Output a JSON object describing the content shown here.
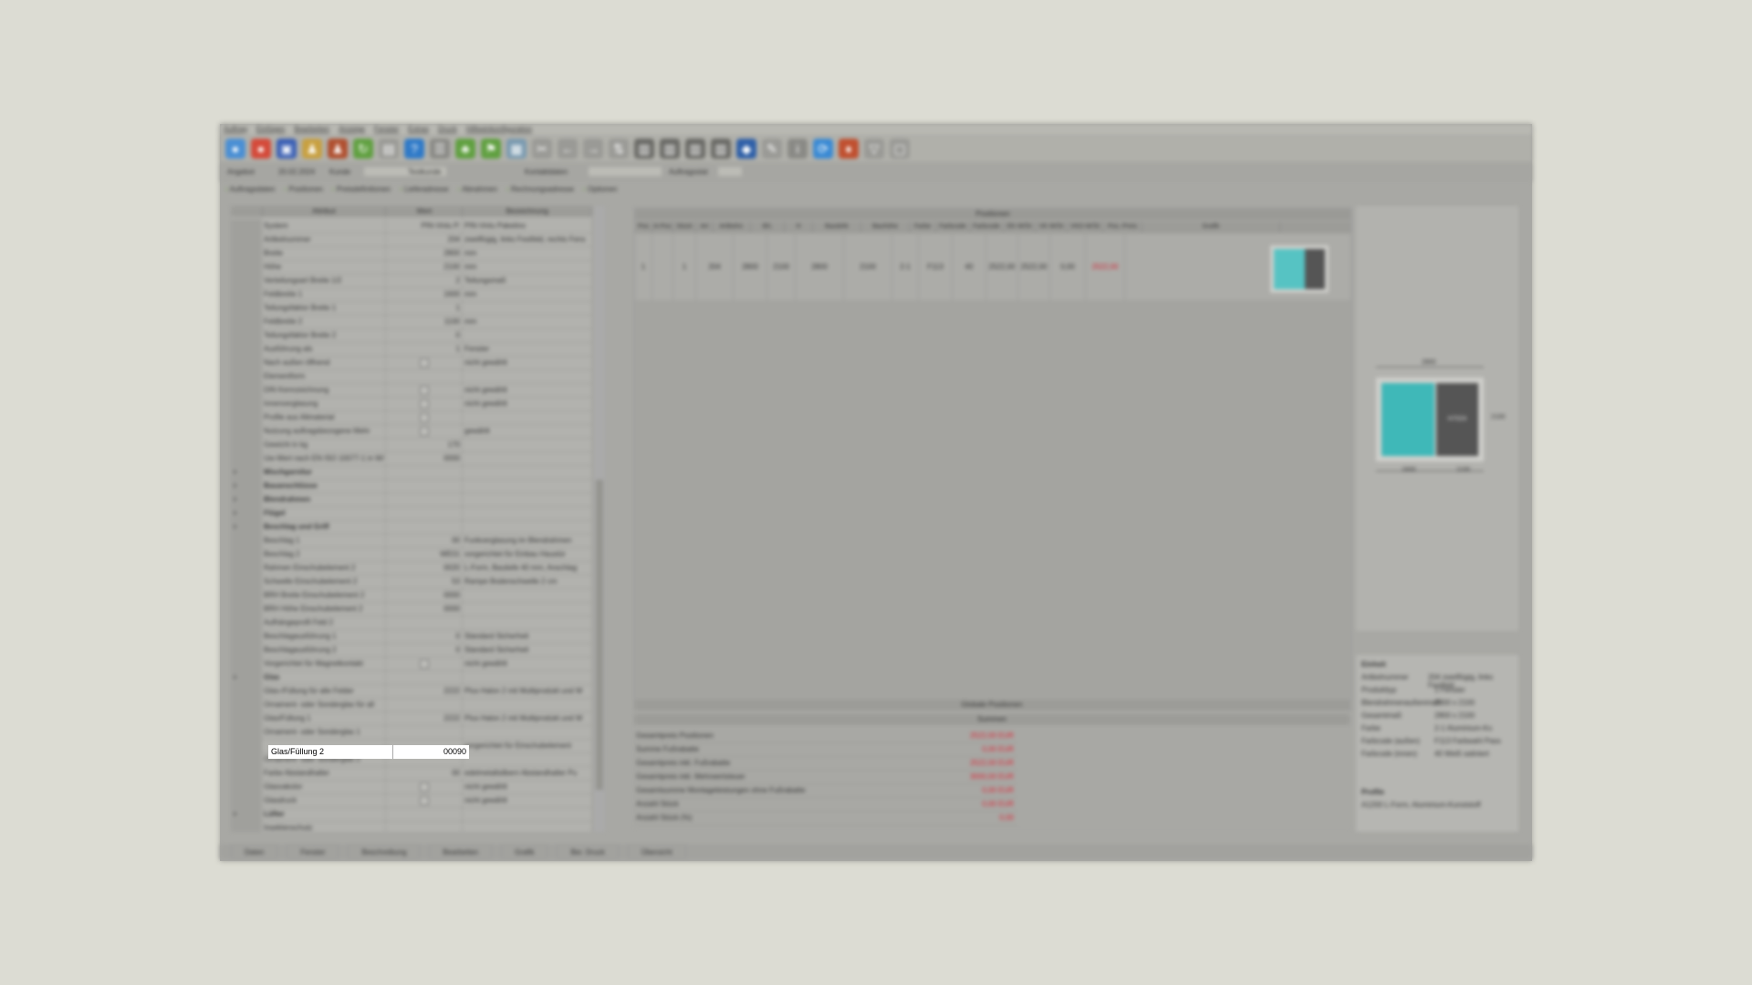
{
  "menu": [
    "Auftrag",
    "Einfügen",
    "Bearbeiten",
    "Anzeige",
    "Fenster",
    "Extras",
    "Druck",
    "Hilfeeinkonfiguration"
  ],
  "infobar": {
    "angebot_label": "Angebot",
    "angebot_value": "20.02.2024",
    "kunde_label": "Kunde",
    "kunde_value": "Testkunde",
    "kontakt_label": "Kontaktdaten",
    "auftrag_label": "Auftragsstat"
  },
  "tabs": [
    "Auftragsdaten",
    "Positionen",
    "Preisdefinitionen",
    "Lieferadresse",
    "Abnahmen",
    "Rechnungsadresse",
    "Optionen"
  ],
  "left_table": {
    "columns": [
      "Attribut",
      "Wert",
      "Bezeichnung"
    ],
    "rows": [
      {
        "attr": "System",
        "val": "PIN-Vinlu P.",
        "desc": "PIN-Vinlu Paketino"
      },
      {
        "attr": "Artikelnummer",
        "val": "204",
        "desc": "zweiflügig, links Festfeld, rechts Fens"
      },
      {
        "attr": "Breite",
        "val": "2800",
        "desc": "mm"
      },
      {
        "attr": "Höhe",
        "val": "2100",
        "desc": "mm"
      },
      {
        "attr": "Verteilungsart Breite 1/2",
        "val": "2",
        "desc": "Teilungsmaß"
      },
      {
        "attr": "Feldbreite 1",
        "val": "1600",
        "desc": "mm"
      },
      {
        "attr": "Teilungsfaktor Breite 1",
        "val": "1",
        "desc": ""
      },
      {
        "attr": "Feldbreite 2",
        "val": "1100",
        "desc": "mm"
      },
      {
        "attr": "Teilungsfaktor Breite 2",
        "val": "0",
        "desc": ""
      },
      {
        "attr": "Ausführung als",
        "val": "1",
        "desc": "Fenster"
      },
      {
        "attr": "Nach außen öffnend",
        "val": "",
        "desc": "nicht gewählt",
        "check": true
      },
      {
        "attr": "Elementform",
        "val": "",
        "desc": ""
      },
      {
        "attr": "DIN Kennzeichnung",
        "val": "",
        "desc": "nicht gewählt",
        "check": true
      },
      {
        "attr": "Innenverglasung",
        "val": "",
        "desc": "nicht gewählt",
        "check": true
      },
      {
        "attr": "Profile aus Altmaterial",
        "val": "",
        "desc": "",
        "check": true
      },
      {
        "attr": "Nutzung auftragsbezogene Mehr",
        "val": "",
        "desc": "gewählt",
        "check": true
      },
      {
        "attr": "Gewicht in kg",
        "val": "170",
        "desc": ""
      },
      {
        "attr": "Uw-Wert nach EN ISO 10077-1 in W/",
        "val": "0000",
        "desc": ""
      },
      {
        "attr": "Mischgarnitur",
        "val": "",
        "desc": "",
        "group": true
      },
      {
        "attr": "Bauanschlüsse",
        "val": "",
        "desc": "",
        "group": true
      },
      {
        "attr": "Blendrahmen",
        "val": "",
        "desc": "",
        "group": true
      },
      {
        "attr": "Flügel",
        "val": "",
        "desc": "",
        "group": true
      },
      {
        "attr": "Beschlag und Griff",
        "val": "",
        "desc": "",
        "group": true
      },
      {
        "attr": "Beschlag 1",
        "val": "00",
        "desc": "Funkverglasung im Blendrahmen"
      },
      {
        "attr": "Beschlag 2",
        "val": "WE01",
        "desc": "vorgerichtet für Einbau Haustür"
      },
      {
        "attr": "Rahmen Einschubelement 2",
        "val": "0020",
        "desc": "L-Form, Bautiefe 40 mm, Anschlag"
      },
      {
        "attr": "Schwelle Einschubelement 2",
        "val": "53",
        "desc": "Rampe Bodenschwelle 2 cm"
      },
      {
        "attr": "BRH Breite Einschubelement 2",
        "val": "0000",
        "desc": ""
      },
      {
        "attr": "BRH Höhe Einschubelement 2",
        "val": "0000",
        "desc": ""
      },
      {
        "attr": "Aufhängeprofil Feld 2",
        "val": "",
        "desc": ""
      },
      {
        "attr": "Beschlagausführung 1",
        "val": "0",
        "desc": "Standard Sicherheit"
      },
      {
        "attr": "Beschlagausführung 2",
        "val": "0",
        "desc": "Standard Sicherheit"
      },
      {
        "attr": "Vorgerichtet für Magnetkontakt",
        "val": "",
        "desc": "nicht gewählt",
        "check": true
      },
      {
        "attr": "Glas",
        "val": "",
        "desc": "",
        "group": true
      },
      {
        "attr": "Glas-/Füllung für alle Felder",
        "val": "2222",
        "desc": "Plus Halon 2 mit Multiprodukt und W"
      },
      {
        "attr": "Ornament- oder Sonderglas für all",
        "val": "",
        "desc": ""
      },
      {
        "attr": "Glas/Füllung 1",
        "val": "2222",
        "desc": "Plus Halon 2 mit Multiprodukt und W"
      },
      {
        "attr": "Ornament- oder Sonderglas 1",
        "val": "",
        "desc": ""
      },
      {
        "attr": "",
        "val": "",
        "desc": "vorgerichtet für Einschubelement"
      },
      {
        "attr": "Ornament- oder Sonderglas 2",
        "val": "",
        "desc": ""
      },
      {
        "attr": "Farbe Abstandhalter",
        "val": "00",
        "desc": "edelmetallsilbern Abstandhalter Pu"
      },
      {
        "attr": "Glasvakolor",
        "val": "",
        "desc": "nicht gewählt",
        "check": true
      },
      {
        "attr": "Glasdruck",
        "val": "",
        "desc": "nicht gewählt",
        "check": true
      },
      {
        "attr": "Lüfter",
        "val": "",
        "desc": "",
        "group": true
      },
      {
        "attr": "Insektenschutz",
        "val": "",
        "desc": ""
      }
    ]
  },
  "edit_row": {
    "label": "Glas/Füllung 2",
    "value": "00090"
  },
  "positions": {
    "title": "Positionen",
    "columns": [
      "Pos",
      "A-Pos",
      "Stück",
      "Art",
      "Artikelnr.",
      "B/L",
      "H",
      "Bautiefe",
      "Bauhöhe",
      "Farbe",
      "Farbcode",
      "Farbcode",
      "EK-W/St",
      "VK-W/St",
      "VKD-W/St",
      "Pos.-Preis",
      "Grafik"
    ],
    "row": [
      "1",
      "",
      "1",
      "204",
      "2800",
      "2100",
      "2800",
      "2100",
      "2-1",
      "F113",
      "40",
      "2522,00",
      "2522,00",
      "0,00",
      "2522,00"
    ]
  },
  "global_positions": "Globale Positionen",
  "sums": {
    "title": "Summen",
    "rows": [
      {
        "label": "Gesamtpreis Positionen",
        "value": "2522,00 EUR"
      },
      {
        "label": "Summe Fußrabatte",
        "value": "0,00 EUR"
      },
      {
        "label": "Gesamtpreis inkl. Fußrabatte",
        "value": "2522,00 EUR"
      },
      {
        "label": "Gesamtpreis inkl. Mehrwertsteuer",
        "value": "3000,00 EUR"
      },
      {
        "label": "Gesamtsumme Montageleistungen ohne Fußrabatte",
        "value": "0,00 EUR"
      },
      {
        "label": "Anzahl Stück",
        "value": "0,00 EUR"
      },
      {
        "label": "Anzahl Stück (%)",
        "value": "0,00"
      }
    ]
  },
  "preview": {
    "dim_top": "2800",
    "dim_right": "2100",
    "dim_bottom_left": "1600",
    "dim_bottom_right": "1100",
    "panel_label": "H7024"
  },
  "info": {
    "section": "Einheit",
    "rows": [
      {
        "k": "Artikelnummer",
        "v": "204 zweiflügig, links Festfeld"
      },
      {
        "k": "Produkttyp",
        "v": "1 Fenster"
      },
      {
        "k": "Blendrahmenaußenmaß",
        "v": "2800 x 2100"
      },
      {
        "k": "Gesamtmaß",
        "v": "2800 x 2100"
      },
      {
        "k": "Farbe",
        "v": "2-1 Aluminium-Ko"
      },
      {
        "k": "Farbcode (außen)",
        "v": "F113 Farbwahl Pass"
      },
      {
        "k": "Farbcode (innen)",
        "v": "40 Weiß satiniert"
      }
    ],
    "section2": "Profile",
    "profile_text": "A1200 L-Form, Aluminium-Kunststoff"
  },
  "statusbar": [
    "Daten",
    "Fenster",
    "Beschreibung",
    "Bearbeiten",
    "Grafik",
    "Ber. Druck",
    "Übersicht"
  ],
  "colors": {
    "glass": "#3fb8b8",
    "frame": "#555555",
    "price_red": "#d22233"
  }
}
